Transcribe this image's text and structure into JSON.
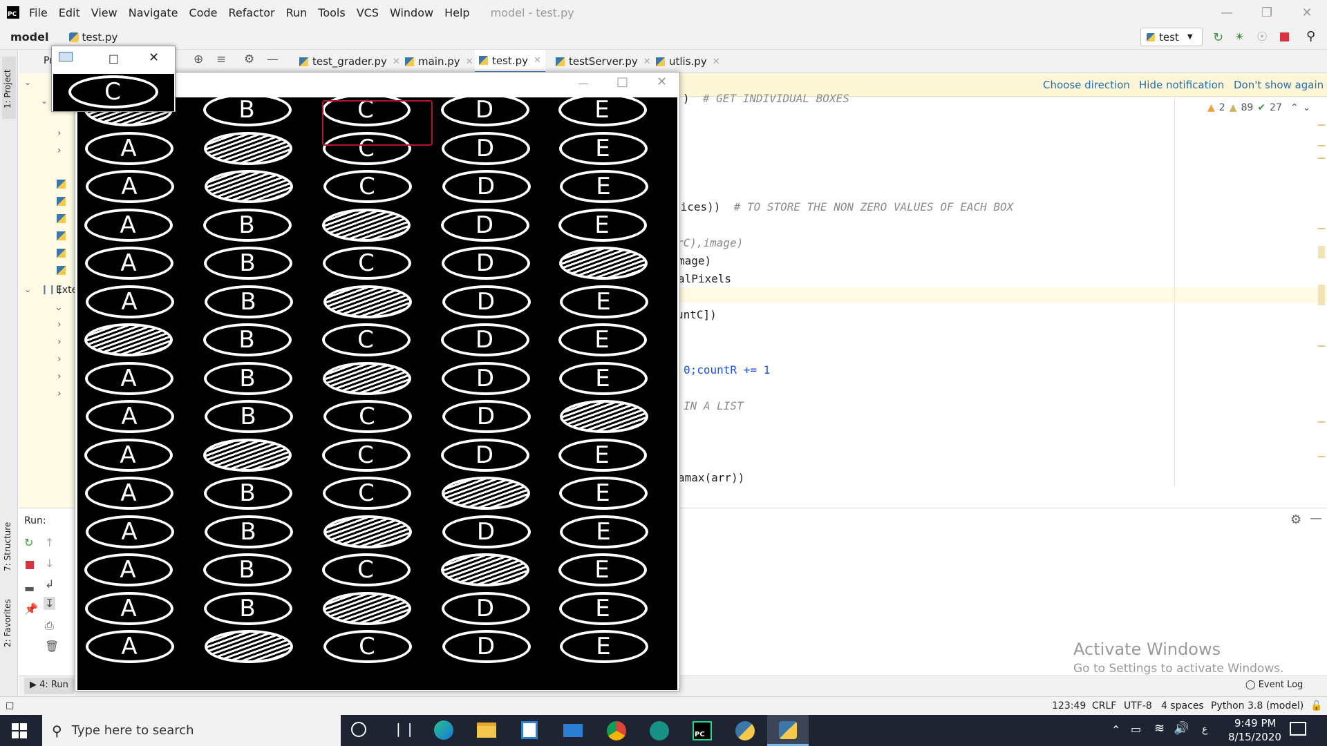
{
  "titlebar": {
    "menu": [
      "File",
      "Edit",
      "View",
      "Navigate",
      "Code",
      "Refactor",
      "Run",
      "Tools",
      "VCS",
      "Window",
      "Help"
    ],
    "title": "model - test.py"
  },
  "navbar": {
    "project": "model",
    "file": "test.py",
    "run_config": "test"
  },
  "tabs": [
    {
      "label": "test_grader.py",
      "active": false
    },
    {
      "label": "main.py",
      "active": false
    },
    {
      "label": "test.py",
      "active": true
    },
    {
      "label": "testServer.py",
      "active": false
    },
    {
      "label": "utlis.py",
      "active": false
    }
  ],
  "notification": {
    "actions": [
      "Choose direction",
      "Hide notification",
      "Don't show again"
    ]
  },
  "inspections": {
    "warnings": "2",
    "weak_warnings": "89",
    "ok": "27"
  },
  "project_panel": {
    "label_pr": "Pr",
    "label_exte": "Exte"
  },
  "sidebar": {
    "project_tab": "1: Project",
    "structure_tab": "7: Structure",
    "favorites_tab": "2: Favorites"
  },
  "editor_lines": [
    {
      "code": ")",
      "comment": "# GET INDIVIDUAL BOXES"
    },
    {
      "code": "oices))",
      "comment": "# TO STORE THE NON ZERO VALUES OF EACH BOX"
    },
    {
      "code": "",
      "comment": "rC),image)"
    },
    {
      "code": "mage)",
      "comment": ""
    },
    {
      "code": "alPixels",
      "comment": ""
    },
    {
      "code": "untC])",
      "comment": ""
    },
    {
      "code": "0;countR += ",
      "num": "1"
    },
    {
      "code": "",
      "comment": "IN A LIST"
    },
    {
      "code": "amax(arr))",
      "comment": ""
    }
  ],
  "run_panel": {
    "label": "Run:"
  },
  "bottom_tabs": {
    "run": "4: Run",
    "event_log": "Event Log"
  },
  "watermark": {
    "title": "Activate Windows",
    "subtitle": "Go to Settings to activate Windows."
  },
  "statusbar": {
    "position": "123:49",
    "line_sep": "CRLF",
    "encoding": "UTF-8",
    "indent": "4 spaces",
    "interpreter": "Python 3.8 (model)"
  },
  "omr_sheet": {
    "letters": [
      "A",
      "B",
      "C",
      "D",
      "E"
    ],
    "filled": [
      0,
      1,
      1,
      2,
      4,
      2,
      0,
      2,
      4,
      1,
      3,
      2,
      3,
      2,
      1
    ],
    "highlighted_row": 0,
    "small_window_letter": "C"
  },
  "taskbar": {
    "search_placeholder": "Type here to search",
    "time": "9:49 PM",
    "date": "8/15/2020",
    "lang": "ع"
  }
}
